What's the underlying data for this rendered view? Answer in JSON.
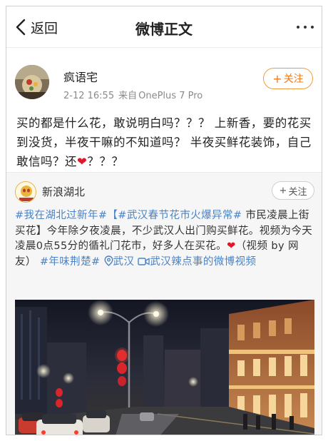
{
  "nav": {
    "back_label": "返回",
    "title": "微博正文"
  },
  "post": {
    "username": "疯语宅",
    "date": "2-12 16:55",
    "source_prefix": "来自",
    "device": "OnePlus 7 Pro",
    "follow_label": "关注",
    "text_before": "买的都是什么花，敢说明白吗？？？ 上新香，要的花买到没货，半夜干嘛的不知道吗？ 半夜买鲜花装饰，自己敢信吗？还",
    "text_after": "？？？"
  },
  "repost": {
    "username": "新浪湖北",
    "follow_label": "关注",
    "tag1": "#我在湖北过新年#",
    "topic": "【#武汉春节花市火爆异常#",
    "text1": " 市民凌晨上街买花】今年除夕夜凌晨，不少武汉人出门购买鲜花。视频为今天凌晨0点55分的循礼门花市，好多人在买花。",
    "video_credit": "（视频 by 网友）",
    "tag2": "#年味荆楚#",
    "location": "武汉",
    "video_link": "武汉辣点事的微博视频"
  },
  "colors": {
    "follow_accent": "#f07a1c",
    "link_blue": "#4a83c6",
    "heart_red": "#e0182d"
  },
  "icons": {
    "back": "chevron-left-icon",
    "more": "ellipsis-icon",
    "heart": "heart-icon",
    "location": "location-pin-icon",
    "video": "video-camera-icon"
  }
}
